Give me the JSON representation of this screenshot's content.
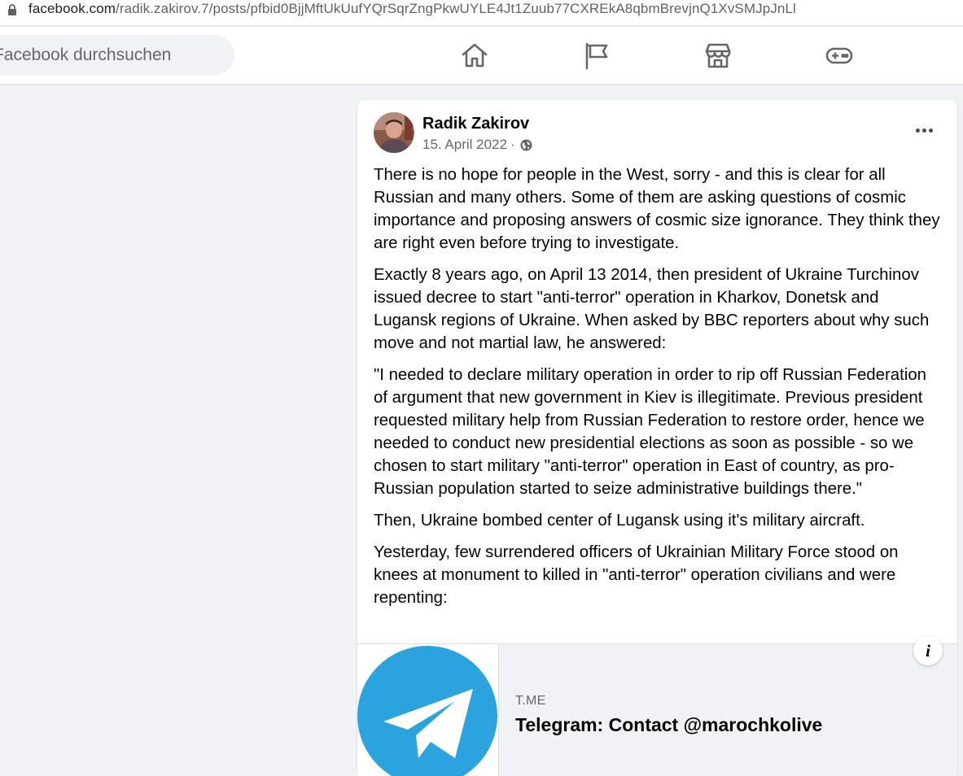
{
  "browser": {
    "url_host": "facebook.com",
    "url_path": "/radik.zakirov.7/posts/pfbid0BjjMftUkUufYQrSqrZngPkwUYLE4Jt1Zuub77CXREkA8qbmBrevjnQ1XvSMJpJnLl"
  },
  "nav": {
    "search_placeholder": "Facebook durchsuchen",
    "icons": [
      "home-icon",
      "pages-flag-icon",
      "marketplace-icon",
      "gaming-icon"
    ]
  },
  "post": {
    "author": "Radik Zakirov",
    "date": "15. April 2022",
    "separator": "·",
    "paragraphs": [
      "There is no hope for people in the West, sorry - and this is clear for all Russian and many others. Some of them are asking questions of cosmic importance and proposing answers of cosmic size ignorance. They think they are right even before trying to investigate.",
      "Exactly 8 years ago, on April 13 2014, then president of Ukraine Turchinov issued decree to start \"anti-terror\" operation in Kharkov, Donetsk and Lugansk regions of Ukraine. When asked by BBC reporters about why such move and not martial law, he answered:",
      "\"I needed to declare military operation in order to rip off Russian Federation of argument that new government in Kiev is illegitimate. Previous president requested military help from Russian Federation to restore order, hence we needed to conduct new presidential elections as soon as possible - so we chosen to start military \"anti-terror\" operation in East of country, as pro-Russian population started to seize administrative buildings there.\"",
      "Then, Ukraine bombed center of Lugansk using it's military aircraft.",
      "Yesterday, few surrendered officers of Ukrainian Military Force stood on knees at monument to killed in \"anti-terror\" operation civilians and were repenting:"
    ],
    "link_preview": {
      "domain": "T.ME",
      "title": "Telegram: Contact @marochkolive",
      "info_label": "i"
    }
  },
  "colors": {
    "telegram_blue": "#2aa3df",
    "secondary_text": "#65676b",
    "background": "#f0f2f5"
  }
}
